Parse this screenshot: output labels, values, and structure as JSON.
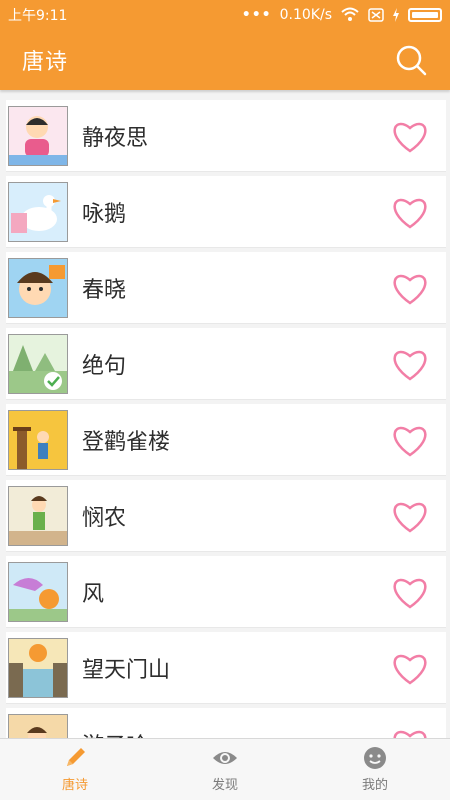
{
  "status_bar": {
    "time": "上午9:11",
    "dots": "•••",
    "network_speed": "0.10K/s"
  },
  "app_bar": {
    "title": "唐诗"
  },
  "poems": [
    {
      "title": "静夜思"
    },
    {
      "title": "咏鹅"
    },
    {
      "title": "春晓"
    },
    {
      "title": "绝句"
    },
    {
      "title": "登鹳雀楼"
    },
    {
      "title": "悯农"
    },
    {
      "title": "风"
    },
    {
      "title": "望天门山"
    },
    {
      "title": "游子吟"
    }
  ],
  "bottom_nav": {
    "tabs": [
      {
        "label": "唐诗",
        "icon": "pencil-icon"
      },
      {
        "label": "发现",
        "icon": "eye-icon"
      },
      {
        "label": "我的",
        "icon": "face-icon"
      }
    ]
  },
  "colors": {
    "primary": "#f59a32",
    "heart": "#f27ea6"
  }
}
